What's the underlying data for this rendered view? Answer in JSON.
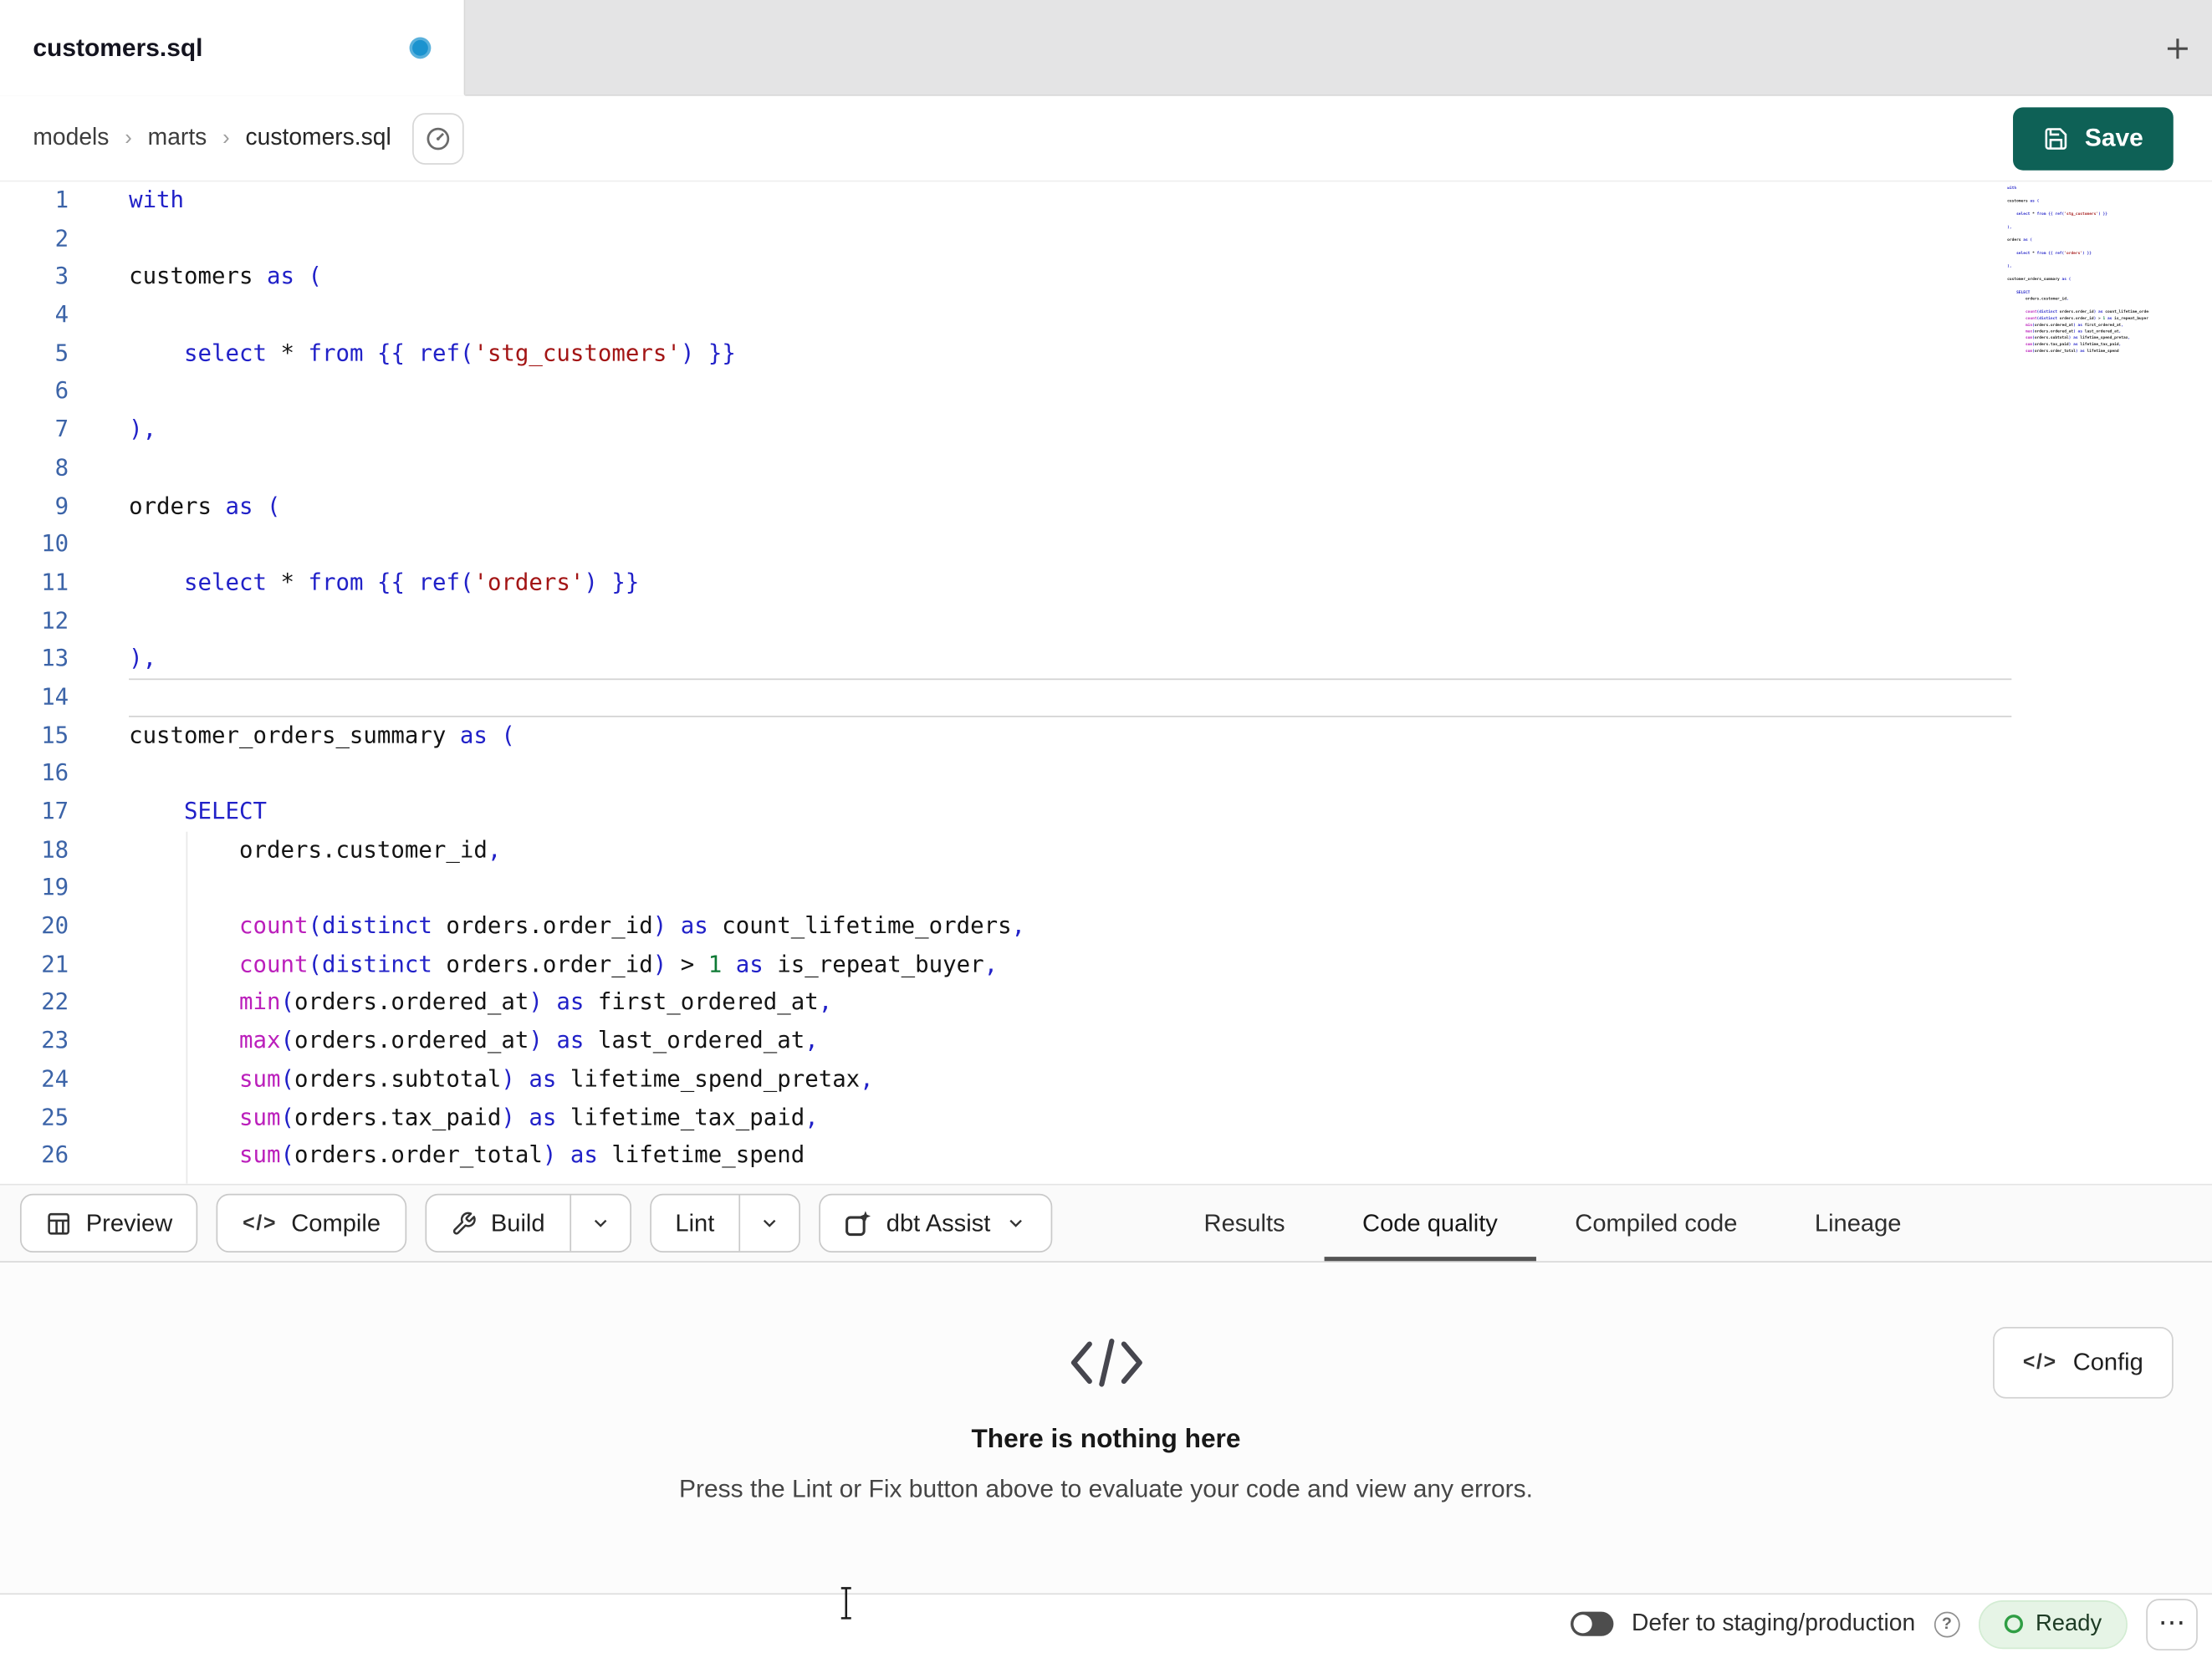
{
  "colors": {
    "save_button_bg": "#0E6156",
    "tab_dirty_dot": "#1B93CF",
    "active_tab_underline": "#545454",
    "keyword": "#2121C8",
    "function": "#BB1FBB",
    "string": "#A31515",
    "number": "#0E7A35",
    "identifier": "#141414",
    "punctuation": "#2121C8",
    "line_number": "#3C64A8",
    "ready_badge_bg": "#E6F4E6",
    "ready_badge_ring": "#2F9E44"
  },
  "icons": {
    "code": "</>"
  },
  "window": {
    "tab": {
      "label": "customers.sql",
      "dirty": true
    }
  },
  "breadcrumb": {
    "items": [
      "models",
      "marts",
      "customers.sql"
    ],
    "separator": "›"
  },
  "save_button": {
    "label": "Save"
  },
  "editor": {
    "language": "sql",
    "active_line": 14,
    "lines": [
      {
        "n": 1,
        "tokens": [
          [
            "kw",
            "with"
          ]
        ]
      },
      {
        "n": 2,
        "tokens": []
      },
      {
        "n": 3,
        "tokens": [
          [
            "id",
            "customers "
          ],
          [
            "kw",
            "as"
          ],
          [
            "id",
            " "
          ],
          [
            "pt",
            "("
          ]
        ]
      },
      {
        "n": 4,
        "tokens": []
      },
      {
        "n": 5,
        "tokens": [
          [
            "id",
            "    "
          ],
          [
            "kw",
            "select"
          ],
          [
            "id",
            " "
          ],
          [
            "op",
            "*"
          ],
          [
            "id",
            " "
          ],
          [
            "kw",
            "from"
          ],
          [
            "id",
            " "
          ],
          [
            "pt",
            "{{"
          ],
          [
            "id",
            " "
          ],
          [
            "kw",
            "ref"
          ],
          [
            "pt",
            "("
          ],
          [
            "str",
            "'stg_customers'"
          ],
          [
            "pt",
            ")"
          ],
          [
            "id",
            " "
          ],
          [
            "pt",
            "}}"
          ]
        ]
      },
      {
        "n": 6,
        "tokens": []
      },
      {
        "n": 7,
        "tokens": [
          [
            "pt",
            "),"
          ]
        ]
      },
      {
        "n": 8,
        "tokens": []
      },
      {
        "n": 9,
        "tokens": [
          [
            "id",
            "orders "
          ],
          [
            "kw",
            "as"
          ],
          [
            "id",
            " "
          ],
          [
            "pt",
            "("
          ]
        ]
      },
      {
        "n": 10,
        "tokens": []
      },
      {
        "n": 11,
        "tokens": [
          [
            "id",
            "    "
          ],
          [
            "kw",
            "select"
          ],
          [
            "id",
            " "
          ],
          [
            "op",
            "*"
          ],
          [
            "id",
            " "
          ],
          [
            "kw",
            "from"
          ],
          [
            "id",
            " "
          ],
          [
            "pt",
            "{{"
          ],
          [
            "id",
            " "
          ],
          [
            "kw",
            "ref"
          ],
          [
            "pt",
            "("
          ],
          [
            "str",
            "'orders'"
          ],
          [
            "pt",
            ")"
          ],
          [
            "id",
            " "
          ],
          [
            "pt",
            "}}"
          ]
        ]
      },
      {
        "n": 12,
        "tokens": []
      },
      {
        "n": 13,
        "tokens": [
          [
            "pt",
            "),"
          ]
        ]
      },
      {
        "n": 14,
        "tokens": []
      },
      {
        "n": 15,
        "tokens": [
          [
            "id",
            "customer_orders_summary "
          ],
          [
            "kw",
            "as"
          ],
          [
            "id",
            " "
          ],
          [
            "pt",
            "("
          ]
        ]
      },
      {
        "n": 16,
        "tokens": []
      },
      {
        "n": 17,
        "tokens": [
          [
            "id",
            "    "
          ],
          [
            "kw",
            "SELECT"
          ]
        ]
      },
      {
        "n": 18,
        "tokens": [
          [
            "id",
            "        orders.customer_id"
          ],
          [
            "pt",
            ","
          ]
        ]
      },
      {
        "n": 19,
        "tokens": []
      },
      {
        "n": 20,
        "tokens": [
          [
            "id",
            "        "
          ],
          [
            "fn",
            "count"
          ],
          [
            "pt",
            "("
          ],
          [
            "kw",
            "distinct"
          ],
          [
            "id",
            " orders.order_id"
          ],
          [
            "pt",
            ")"
          ],
          [
            "id",
            " "
          ],
          [
            "kw",
            "as"
          ],
          [
            "id",
            " count_lifetime_orders"
          ],
          [
            "pt",
            ","
          ]
        ]
      },
      {
        "n": 21,
        "tokens": [
          [
            "id",
            "        "
          ],
          [
            "fn",
            "count"
          ],
          [
            "pt",
            "("
          ],
          [
            "kw",
            "distinct"
          ],
          [
            "id",
            " orders.order_id"
          ],
          [
            "pt",
            ")"
          ],
          [
            "id",
            " "
          ],
          [
            "op",
            ">"
          ],
          [
            "id",
            " "
          ],
          [
            "num",
            "1"
          ],
          [
            "id",
            " "
          ],
          [
            "kw",
            "as"
          ],
          [
            "id",
            " is_repeat_buyer"
          ],
          [
            "pt",
            ","
          ]
        ]
      },
      {
        "n": 22,
        "tokens": [
          [
            "id",
            "        "
          ],
          [
            "fn",
            "min"
          ],
          [
            "pt",
            "("
          ],
          [
            "id",
            "orders.ordered_at"
          ],
          [
            "pt",
            ")"
          ],
          [
            "id",
            " "
          ],
          [
            "kw",
            "as"
          ],
          [
            "id",
            " first_ordered_at"
          ],
          [
            "pt",
            ","
          ]
        ]
      },
      {
        "n": 23,
        "tokens": [
          [
            "id",
            "        "
          ],
          [
            "fn",
            "max"
          ],
          [
            "pt",
            "("
          ],
          [
            "id",
            "orders.ordered_at"
          ],
          [
            "pt",
            ")"
          ],
          [
            "id",
            " "
          ],
          [
            "kw",
            "as"
          ],
          [
            "id",
            " last_ordered_at"
          ],
          [
            "pt",
            ","
          ]
        ]
      },
      {
        "n": 24,
        "tokens": [
          [
            "id",
            "        "
          ],
          [
            "fn",
            "sum"
          ],
          [
            "pt",
            "("
          ],
          [
            "id",
            "orders.subtotal"
          ],
          [
            "pt",
            ")"
          ],
          [
            "id",
            " "
          ],
          [
            "kw",
            "as"
          ],
          [
            "id",
            " lifetime_spend_pretax"
          ],
          [
            "pt",
            ","
          ]
        ]
      },
      {
        "n": 25,
        "tokens": [
          [
            "id",
            "        "
          ],
          [
            "fn",
            "sum"
          ],
          [
            "pt",
            "("
          ],
          [
            "id",
            "orders.tax_paid"
          ],
          [
            "pt",
            ")"
          ],
          [
            "id",
            " "
          ],
          [
            "kw",
            "as"
          ],
          [
            "id",
            " lifetime_tax_paid"
          ],
          [
            "pt",
            ","
          ]
        ]
      },
      {
        "n": 26,
        "tokens": [
          [
            "id",
            "        "
          ],
          [
            "fn",
            "sum"
          ],
          [
            "pt",
            "("
          ],
          [
            "id",
            "orders.order_total"
          ],
          [
            "pt",
            ")"
          ],
          [
            "id",
            " "
          ],
          [
            "kw",
            "as"
          ],
          [
            "id",
            " lifetime_spend"
          ]
        ]
      }
    ]
  },
  "toolbar": {
    "preview": {
      "label": "Preview"
    },
    "compile": {
      "label": "Compile"
    },
    "build": {
      "label": "Build"
    },
    "lint": {
      "label": "Lint"
    },
    "assist": {
      "label": "dbt Assist"
    },
    "tabs": {
      "results": "Results",
      "code_quality": "Code quality",
      "compiled": "Compiled code",
      "lineage": "Lineage"
    },
    "active_tab": "Code quality"
  },
  "results_panel": {
    "config_button": {
      "label": "Config"
    },
    "empty_icon": "</>",
    "empty_title": "There is nothing here",
    "empty_subtitle": "Press the Lint or Fix button above to evaluate your code and view any errors."
  },
  "status_bar": {
    "defer_toggle": {
      "label": "Defer to staging/production",
      "on": false
    },
    "help_icon": "?",
    "ready_status": {
      "label": "Ready"
    },
    "overflow_icon": "⋯"
  }
}
